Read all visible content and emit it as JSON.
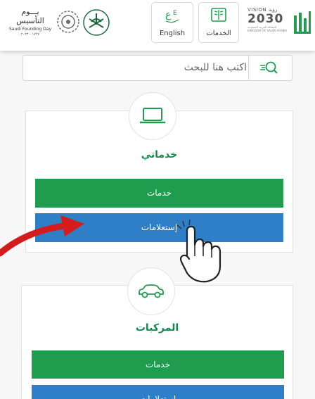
{
  "header": {
    "founding_ar": "يـــوم التأسيس",
    "founding_en": "Saudi Founding Day",
    "founding_years": "١٧٢٧ - ٢٠٢٣",
    "english_label": "English",
    "services_label": "الخدمات",
    "vision_text": "VISION رؤية",
    "vision_year": "2030",
    "vision_sub": "المملكة العربية السعودية KINGDOM OF SAUDI ARABIA"
  },
  "search": {
    "placeholder": "اكتب هنا للبحث"
  },
  "sections": [
    {
      "title": "خدماتي",
      "icon": "laptop-icon",
      "buttons": [
        "خدمات",
        "إستعلامات"
      ]
    },
    {
      "title": "المركبات",
      "icon": "car-icon",
      "buttons": [
        "خدمات",
        "إستعلامات"
      ]
    }
  ],
  "colors": {
    "green": "#1f9c4e",
    "blue": "#2f7ec8",
    "title_green": "#138a4a",
    "annotation_red": "#d41c1c"
  }
}
